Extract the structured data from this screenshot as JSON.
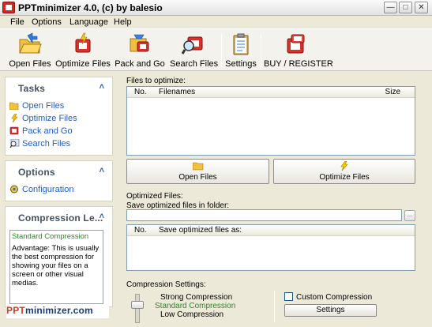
{
  "window": {
    "title": "PPTminimizer 4.0, (c) by balesio",
    "min_label": "—",
    "max_label": "□",
    "close_label": "✕"
  },
  "menu": {
    "items": [
      "File",
      "Options",
      "Language",
      "Help"
    ]
  },
  "toolbar": {
    "buttons": [
      {
        "label": "Open Files",
        "icon": "open-folder-icon"
      },
      {
        "label": "Optimize Files",
        "icon": "optimize-icon"
      },
      {
        "label": "Pack and Go",
        "icon": "pack-and-go-icon"
      },
      {
        "label": "Search Files",
        "icon": "search-files-icon"
      },
      {
        "label": "Settings",
        "icon": "settings-clipboard-icon"
      },
      {
        "label": "BUY / REGISTER",
        "icon": "buy-register-icon"
      }
    ]
  },
  "sidebar": {
    "tasks": {
      "title": "Tasks",
      "collapse": "˄",
      "links": [
        "Open Files",
        "Optimize Files",
        "Pack and Go",
        "Search Files"
      ]
    },
    "options": {
      "title": "Options",
      "collapse": "˄",
      "links": [
        "Configuration"
      ]
    },
    "compression": {
      "title": "Compression Le...",
      "collapse": "˄",
      "level": "Standard Compression",
      "description": "Advantage: This is usually the best compression for showing your files on a screen or other visual medias."
    },
    "brand": {
      "ppt": "PPT",
      "rest": "minimizer.com"
    }
  },
  "main": {
    "files_label": "Files to optimize:",
    "files_columns": {
      "no": "No.",
      "filenames": "Filenames",
      "size": "Size"
    },
    "open_button": "Open Files",
    "optimize_button": "Optimize Files",
    "optimized_label": "Optimized Files:",
    "save_folder_label": "Save optimized files in folder:",
    "folder_value": "",
    "browse_label": "...",
    "optimized_columns": {
      "no": "No.",
      "save_as": "Save optimized files as:"
    },
    "compression_settings_label": "Compression Settings:",
    "levels": {
      "strong": "Strong Compression",
      "standard": "Standard Compression",
      "low": "Low Compression"
    },
    "custom_label": "Custom Compression",
    "settings_button": "Settings",
    "standard_color": "#2a8a2a"
  }
}
